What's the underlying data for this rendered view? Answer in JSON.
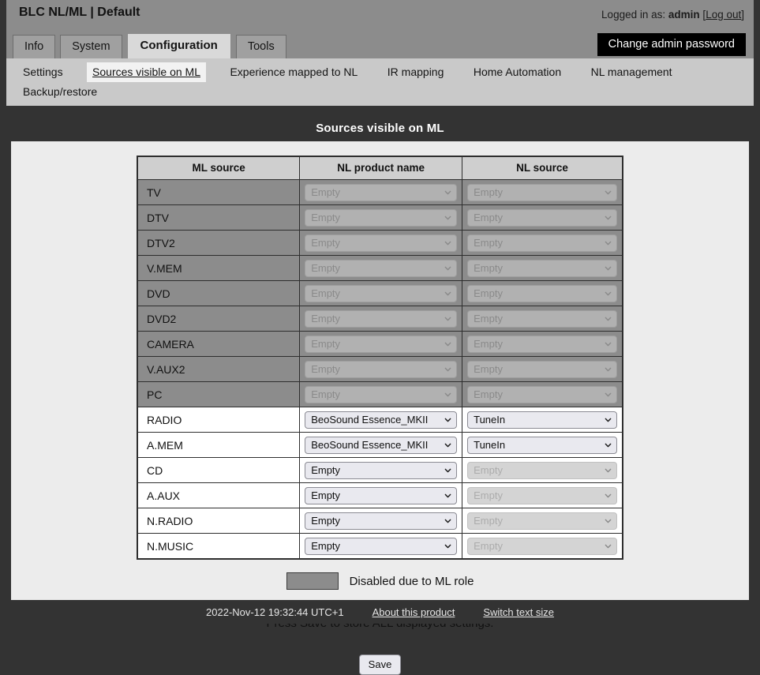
{
  "header": {
    "app_title": "BLC NL/ML | Default",
    "logged_in_prefix": "Logged in as:",
    "username": "admin",
    "logout_open_bracket": "[",
    "logout_label": "Log out",
    "logout_close_bracket": "]",
    "change_password_button": "Change admin password"
  },
  "tabs": [
    {
      "label": "Info",
      "active": false
    },
    {
      "label": "System",
      "active": false
    },
    {
      "label": "Configuration",
      "active": true
    },
    {
      "label": "Tools",
      "active": false
    }
  ],
  "subnav": [
    {
      "label": "Settings",
      "active": false
    },
    {
      "label": "Sources visible on ML",
      "active": true
    },
    {
      "label": "Experience mapped to NL",
      "active": false
    },
    {
      "label": "IR mapping",
      "active": false
    },
    {
      "label": "Home Automation",
      "active": false
    },
    {
      "label": "NL management",
      "active": false
    },
    {
      "label": "Backup/restore",
      "active": false
    }
  ],
  "panel": {
    "title": "Sources visible on ML",
    "columns": [
      "ML source",
      "NL product name",
      "NL source"
    ],
    "rows": [
      {
        "ml_source": "TV",
        "nl_product": "Empty",
        "nl_source": "Empty",
        "disabled": true
      },
      {
        "ml_source": "DTV",
        "nl_product": "Empty",
        "nl_source": "Empty",
        "disabled": true
      },
      {
        "ml_source": "DTV2",
        "nl_product": "Empty",
        "nl_source": "Empty",
        "disabled": true
      },
      {
        "ml_source": "V.MEM",
        "nl_product": "Empty",
        "nl_source": "Empty",
        "disabled": true
      },
      {
        "ml_source": "DVD",
        "nl_product": "Empty",
        "nl_source": "Empty",
        "disabled": true
      },
      {
        "ml_source": "DVD2",
        "nl_product": "Empty",
        "nl_source": "Empty",
        "disabled": true
      },
      {
        "ml_source": "CAMERA",
        "nl_product": "Empty",
        "nl_source": "Empty",
        "disabled": true
      },
      {
        "ml_source": "V.AUX2",
        "nl_product": "Empty",
        "nl_source": "Empty",
        "disabled": true
      },
      {
        "ml_source": "PC",
        "nl_product": "Empty",
        "nl_source": "Empty",
        "disabled": true
      },
      {
        "ml_source": "RADIO",
        "nl_product": "BeoSound Essence_MKII",
        "nl_source": "TuneIn",
        "disabled": false,
        "nl_source_disabled": false
      },
      {
        "ml_source": "A.MEM",
        "nl_product": "BeoSound Essence_MKII",
        "nl_source": "TuneIn",
        "disabled": false,
        "nl_source_disabled": false
      },
      {
        "ml_source": "CD",
        "nl_product": "Empty",
        "nl_source": "Empty",
        "disabled": false,
        "nl_source_disabled": true
      },
      {
        "ml_source": "A.AUX",
        "nl_product": "Empty",
        "nl_source": "Empty",
        "disabled": false,
        "nl_source_disabled": true
      },
      {
        "ml_source": "N.RADIO",
        "nl_product": "Empty",
        "nl_source": "Empty",
        "disabled": false,
        "nl_source_disabled": true
      },
      {
        "ml_source": "N.MUSIC",
        "nl_product": "Empty",
        "nl_source": "Empty",
        "disabled": false,
        "nl_source_disabled": true
      }
    ],
    "legend_text": "Disabled due to ML role",
    "hint_text": "Press Save to store ALL displayed settings.",
    "save_label": "Save"
  },
  "statusbar": {
    "timestamp": "2022-Nov-12 19:32:44 UTC+1",
    "about_link": "About this product",
    "textsize_link": "Switch text size"
  },
  "colors": {
    "header_gray": "#8c8c8c",
    "dark": "#333333",
    "panel_bg": "#ececec",
    "subnav_bg": "#c9c9c9",
    "disabled_row": "#8c8c8c",
    "select_enabled_bg": "#e9e9ef",
    "select_disabled_bg": "#c2c2c2",
    "accent_black_button": "#000000"
  }
}
